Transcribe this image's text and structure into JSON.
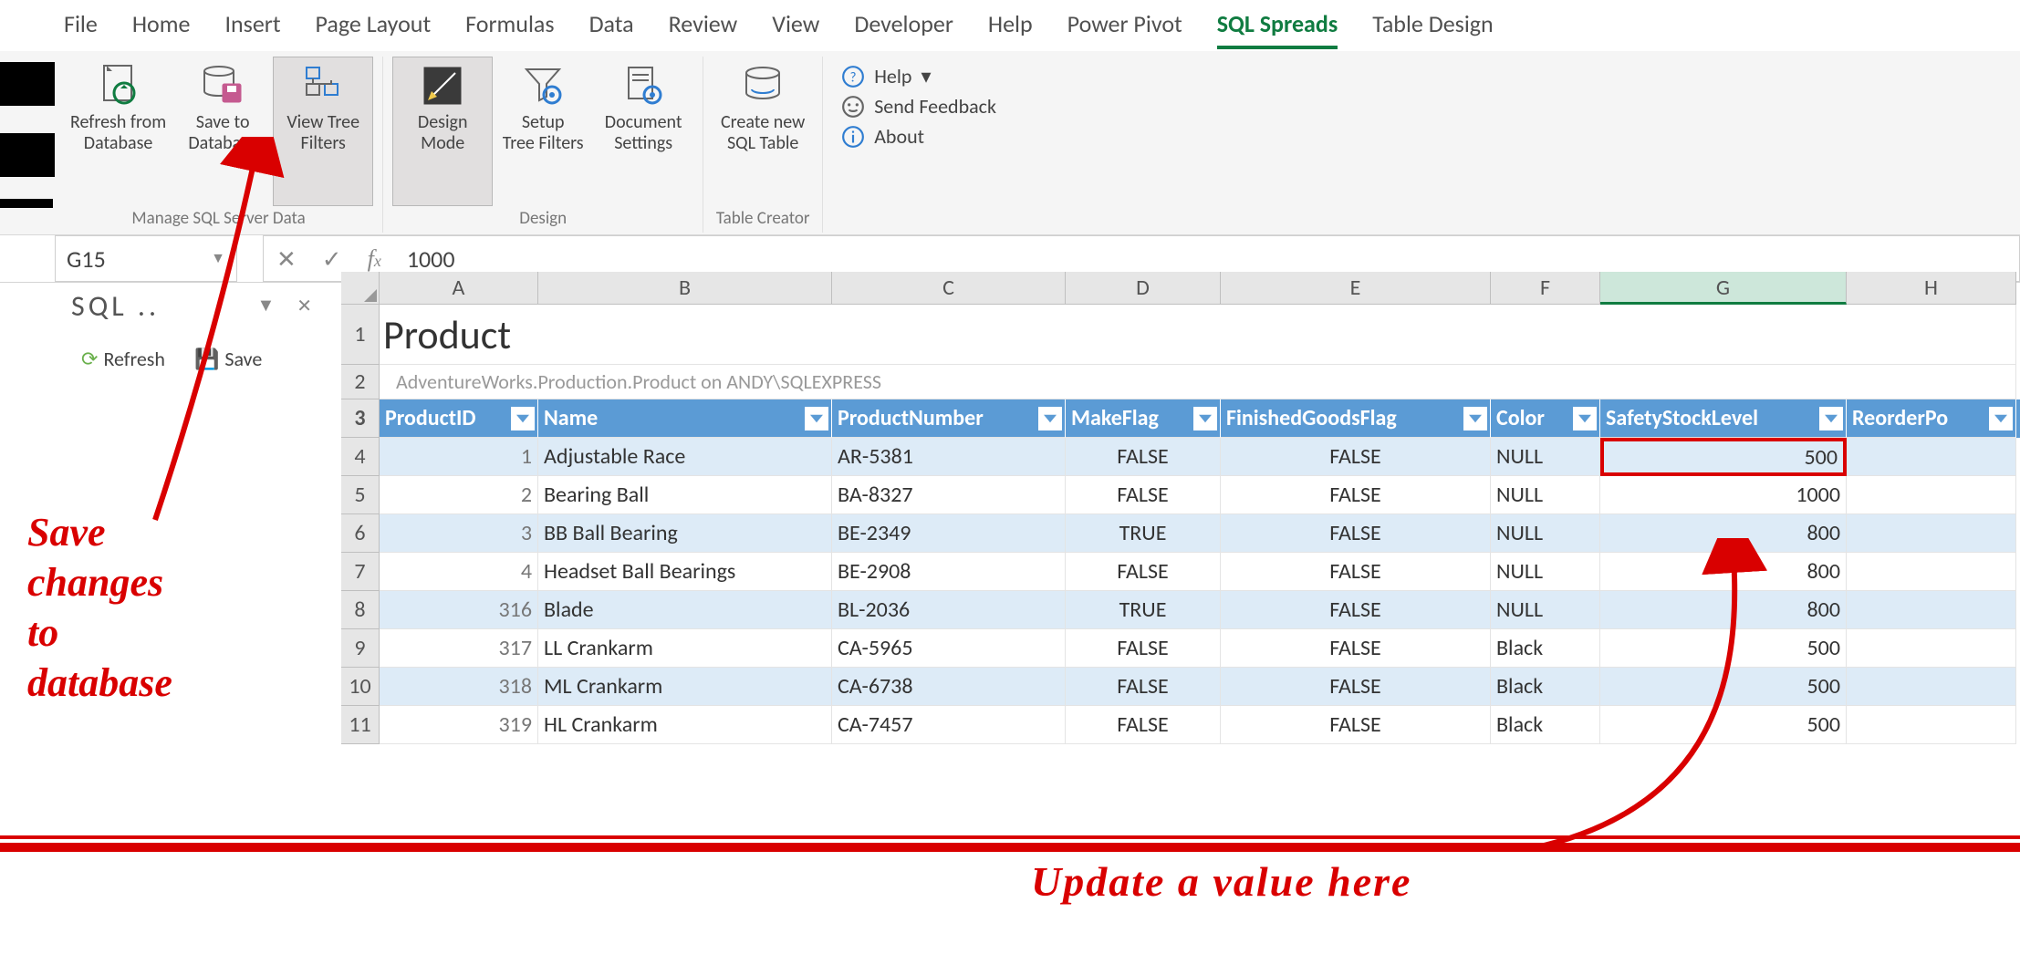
{
  "tabs": [
    "File",
    "Home",
    "Insert",
    "Page Layout",
    "Formulas",
    "Data",
    "Review",
    "View",
    "Developer",
    "Help",
    "Power Pivot",
    "SQL Spreads",
    "Table Design"
  ],
  "active_tab_index": 11,
  "ribbon": {
    "manage": {
      "label": "Manage SQL Server Data",
      "buttons": {
        "refresh": "Refresh from\nDatabase",
        "save": "Save to\nDatabase",
        "viewtree": "View Tree\nFilters"
      }
    },
    "design": {
      "label": "Design",
      "buttons": {
        "designmode": "Design\nMode",
        "setuptree": "Setup\nTree Filters",
        "docsettings": "Document\nSettings"
      }
    },
    "creator": {
      "label": "Table Creator",
      "buttons": {
        "createnew": "Create new\nSQL Table"
      }
    },
    "support": {
      "help": "Help",
      "feedback": "Send Feedback",
      "about": "About"
    }
  },
  "formula_bar": {
    "name_box": "G15",
    "value": "1000"
  },
  "side_panel": {
    "title": "SQL ..",
    "refresh": "Refresh",
    "save": "Save"
  },
  "sheet": {
    "column_letters": [
      "A",
      "B",
      "C",
      "D",
      "E",
      "F",
      "G",
      "H"
    ],
    "selected_col": "G",
    "title": "Product",
    "subtitle": "AdventureWorks.Production.Product on ANDY\\SQLEXPRESS",
    "headers": [
      "ProductID",
      "Name",
      "ProductNumber",
      "MakeFlag",
      "FinishedGoodsFlag",
      "Color",
      "SafetyStockLevel",
      "ReorderPo"
    ],
    "rows": [
      {
        "n": 4,
        "id": "1",
        "name": "Adjustable Race",
        "num": "AR-5381",
        "make": "FALSE",
        "fin": "FALSE",
        "color": "NULL",
        "stock": "500"
      },
      {
        "n": 5,
        "id": "2",
        "name": "Bearing Ball",
        "num": "BA-8327",
        "make": "FALSE",
        "fin": "FALSE",
        "color": "NULL",
        "stock": "1000"
      },
      {
        "n": 6,
        "id": "3",
        "name": "BB Ball Bearing",
        "num": "BE-2349",
        "make": "TRUE",
        "fin": "FALSE",
        "color": "NULL",
        "stock": "800"
      },
      {
        "n": 7,
        "id": "4",
        "name": "Headset Ball Bearings",
        "num": "BE-2908",
        "make": "FALSE",
        "fin": "FALSE",
        "color": "NULL",
        "stock": "800"
      },
      {
        "n": 8,
        "id": "316",
        "name": "Blade",
        "num": "BL-2036",
        "make": "TRUE",
        "fin": "FALSE",
        "color": "NULL",
        "stock": "800"
      },
      {
        "n": 9,
        "id": "317",
        "name": "LL Crankarm",
        "num": "CA-5965",
        "make": "FALSE",
        "fin": "FALSE",
        "color": "Black",
        "stock": "500"
      },
      {
        "n": 10,
        "id": "318",
        "name": "ML Crankarm",
        "num": "CA-6738",
        "make": "FALSE",
        "fin": "FALSE",
        "color": "Black",
        "stock": "500"
      },
      {
        "n": 11,
        "id": "319",
        "name": "HL Crankarm",
        "num": "CA-7457",
        "make": "FALSE",
        "fin": "FALSE",
        "color": "Black",
        "stock": "500"
      }
    ],
    "highlight_row": 0
  },
  "annotations": {
    "left": "Save\nchanges\nto\ndatabase",
    "bottom": "Update a value here"
  }
}
